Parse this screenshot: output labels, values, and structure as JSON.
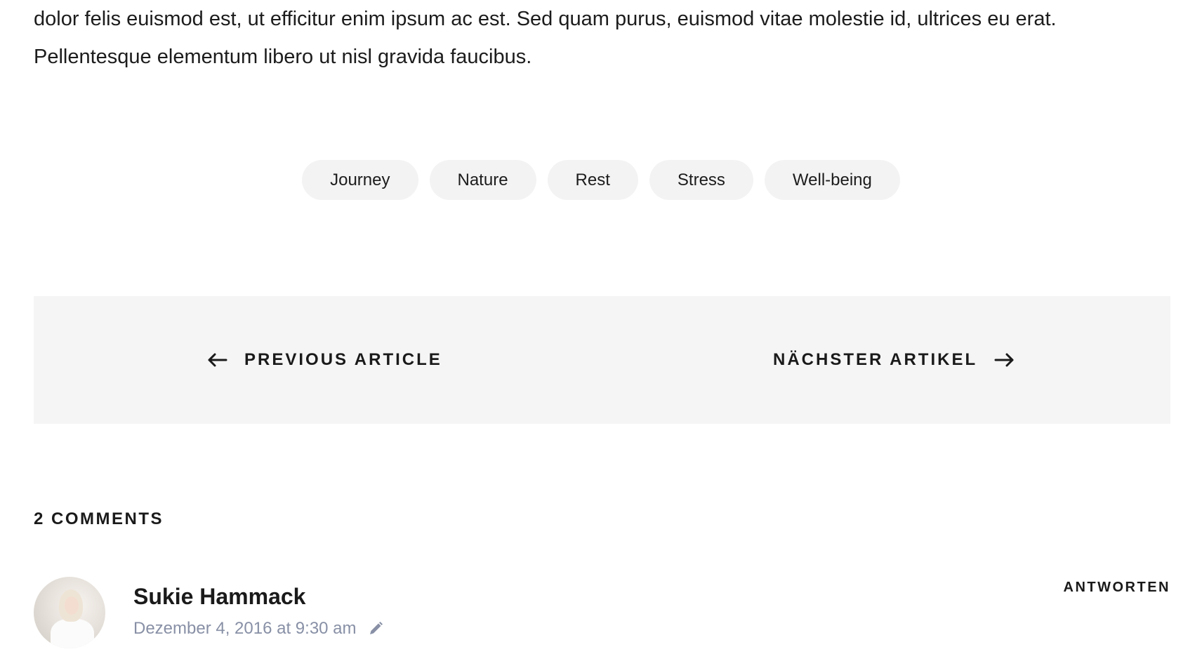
{
  "article": {
    "line1": "dolor felis euismod est, ut efficitur enim ipsum ac est. Sed quam purus, euismod vitae molestie id, ultrices eu erat.",
    "line2": "Pellentesque elementum libero ut nisl gravida faucibus."
  },
  "tags": [
    "Journey",
    "Nature",
    "Rest",
    "Stress",
    "Well-being"
  ],
  "post_nav": {
    "previous_label": "PREVIOUS ARTICLE",
    "previous_icon": "arrow-left-icon",
    "next_label": "NÄCHSTER ARTIKEL",
    "next_icon": "arrow-right-icon"
  },
  "comments": {
    "title": "2 COMMENTS",
    "items": [
      {
        "author": "Sukie Hammack",
        "date": "Dezember 4, 2016 at 9:30 am",
        "edit_icon": "pencil-icon",
        "reply_label": "ANTWORTEN"
      }
    ]
  },
  "colors": {
    "text": "#1a1a1a",
    "meta": "#8890a6",
    "tag_bg": "#f3f3f3",
    "nav_bg": "#f5f5f5"
  }
}
